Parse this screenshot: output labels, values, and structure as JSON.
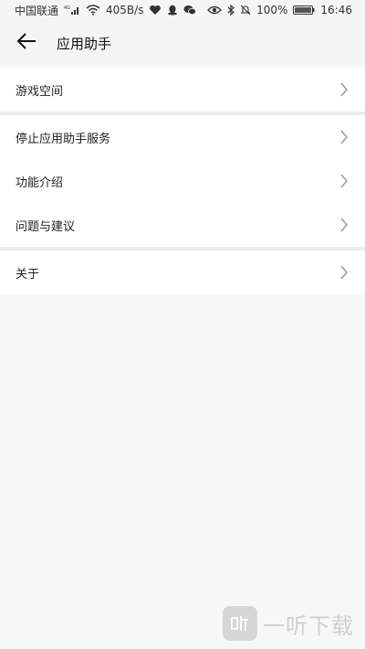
{
  "status_bar": {
    "carrier": "中国联通",
    "network": "4G",
    "speed": "405B/s",
    "battery": "100%",
    "time": "16:46"
  },
  "header": {
    "title": "应用助手"
  },
  "menu": {
    "items": [
      {
        "label": "游戏空间"
      },
      {
        "label": "停止应用助手服务"
      },
      {
        "label": "功能介绍"
      },
      {
        "label": "问题与建议"
      },
      {
        "label": "关于"
      }
    ]
  },
  "watermark": {
    "text": "一听下载"
  },
  "icons": {
    "back": "arrow-left-icon",
    "chevron": "chevron-right-icon"
  },
  "colors": {
    "background": "#f5f5f5",
    "item_background": "#ffffff",
    "divider": "#eeeeee",
    "chevron": "#9a9a9a"
  }
}
